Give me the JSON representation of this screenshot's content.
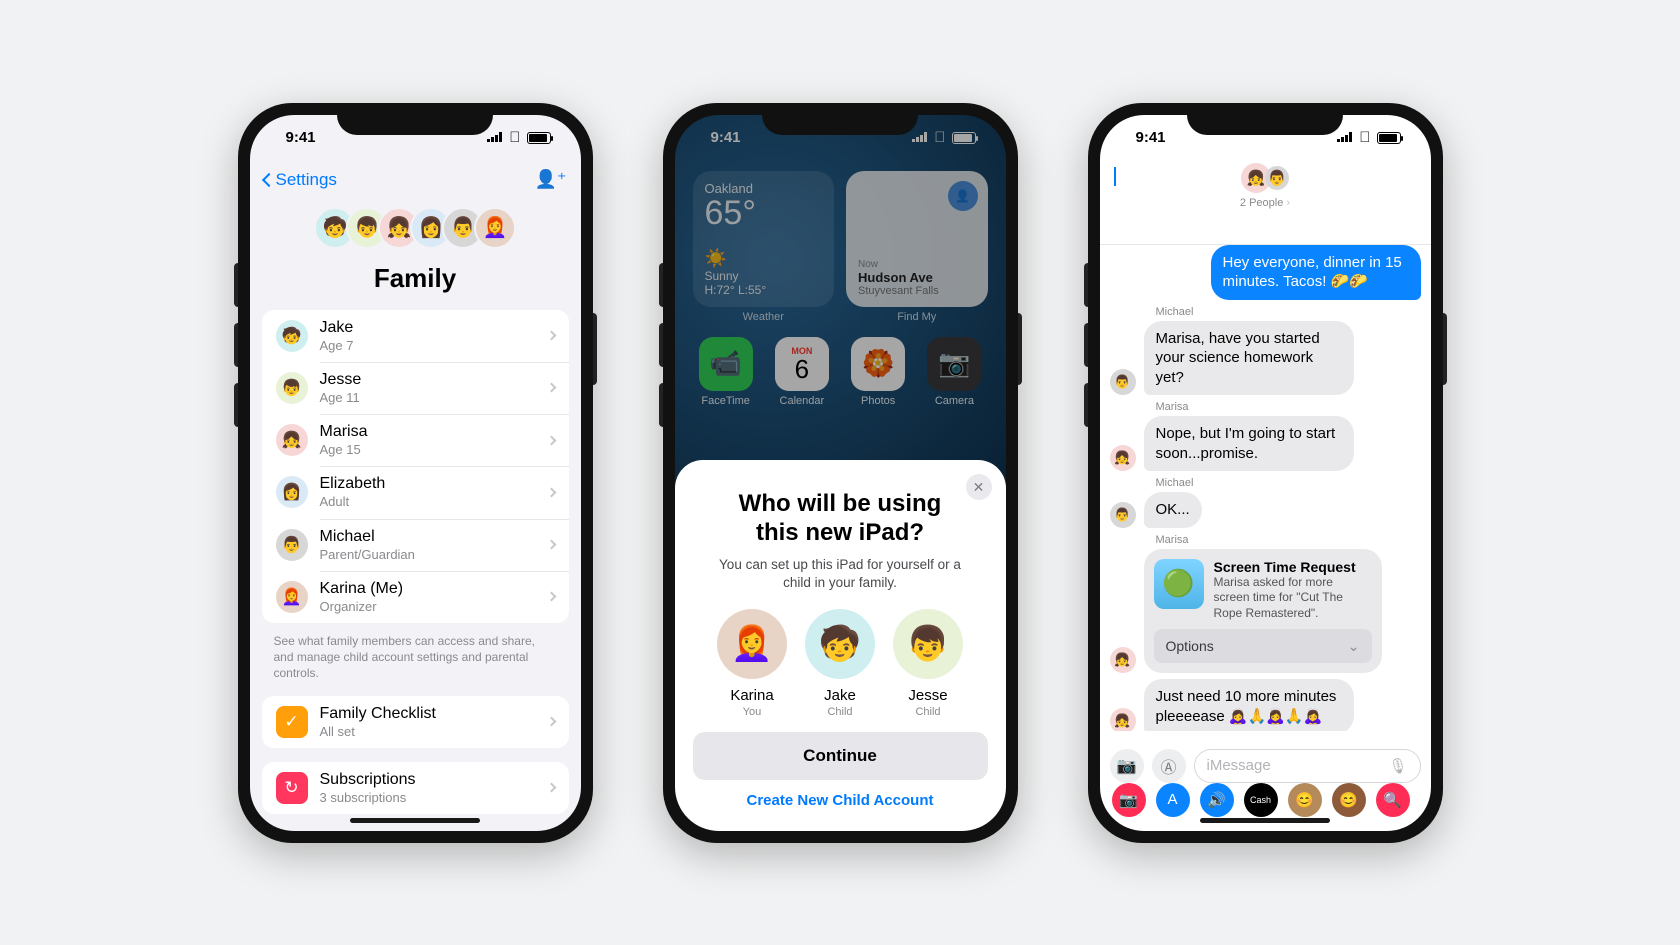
{
  "status_time": "9:41",
  "p1": {
    "back_label": "Settings",
    "title": "Family",
    "members": [
      {
        "name": "Jake",
        "sub": "Age 7",
        "cls": "c5",
        "emoji": "🧒"
      },
      {
        "name": "Jesse",
        "sub": "Age 11",
        "cls": "c4",
        "emoji": "👦"
      },
      {
        "name": "Marisa",
        "sub": "Age 15",
        "cls": "c3",
        "emoji": "👧"
      },
      {
        "name": "Elizabeth",
        "sub": "Adult",
        "cls": "c1",
        "emoji": "👩"
      },
      {
        "name": "Michael",
        "sub": "Parent/Guardian",
        "cls": "c2",
        "emoji": "👨"
      },
      {
        "name": "Karina (Me)",
        "sub": "Organizer",
        "cls": "c0",
        "emoji": "👩‍🦰"
      }
    ],
    "hint": "See what family members can access and share, and manage child account settings and parental controls.",
    "checklist_title": "Family Checklist",
    "checklist_sub": "All set",
    "subs_title": "Subscriptions",
    "subs_sub": "3 subscriptions"
  },
  "p2": {
    "weather": {
      "city": "Oakland",
      "temp": "65°",
      "cond": "Sunny",
      "hilo": "H:72° L:55°",
      "label": "Weather"
    },
    "findmy": {
      "now": "Now",
      "place": "Hudson Ave",
      "area": "Stuyvesant Falls",
      "label": "Find My"
    },
    "cal_dow": "MON",
    "cal_day": "6",
    "apps": [
      {
        "label": "FaceTime",
        "color": "#30d158",
        "glyph": "📹"
      },
      {
        "label": "Calendar",
        "color": "#ffffff",
        "glyph": ""
      },
      {
        "label": "Photos",
        "color": "#ffffff",
        "glyph": "🏵️"
      },
      {
        "label": "Camera",
        "color": "#3a3a3c",
        "glyph": "📷"
      }
    ],
    "sheet": {
      "title": "Who will be using this new iPad?",
      "desc": "You can set up this iPad for yourself or a child in your family.",
      "people": [
        {
          "name": "Karina",
          "role": "You",
          "cls": "c0",
          "emoji": "👩‍🦰"
        },
        {
          "name": "Jake",
          "role": "Child",
          "cls": "c5",
          "emoji": "🧒"
        },
        {
          "name": "Jesse",
          "role": "Child",
          "cls": "c4",
          "emoji": "👦"
        }
      ],
      "continue": "Continue",
      "create": "Create New Child Account"
    }
  },
  "p3": {
    "count_label": "2 People",
    "outgoing": "Hey everyone, dinner in 15 minutes. Tacos! 🌮🌮",
    "msgs": [
      {
        "who": "Michael",
        "text": "Marisa, have you started your science homework yet?",
        "cls": "c2",
        "emoji": "👨"
      },
      {
        "who": "Marisa",
        "text": "Nope, but I'm going to start soon...promise.",
        "cls": "c3",
        "emoji": "👧"
      },
      {
        "who": "Michael",
        "text": "OK...",
        "cls": "c2",
        "emoji": "👨"
      }
    ],
    "req_who": "Marisa",
    "req_title": "Screen Time Request",
    "req_body": "Marisa asked for more screen time for \"Cut The Rope Remastered\".",
    "req_options": "Options",
    "req_plead": "Just need 10 more minutes pleeeease 🙇‍♀️🙏🙇‍♀️🙏🙇‍♀️",
    "placeholder": "iMessage",
    "apprail_colors": [
      "#ff2d55",
      "#0a84ff",
      "#0a84ff",
      "#000",
      "#b58a5a",
      "#8e5b3a",
      "#ff2d55"
    ],
    "apprail_glyphs": [
      "📷",
      "A",
      "🔊",
      "Cash",
      "😊",
      "😊",
      "🔍"
    ]
  }
}
